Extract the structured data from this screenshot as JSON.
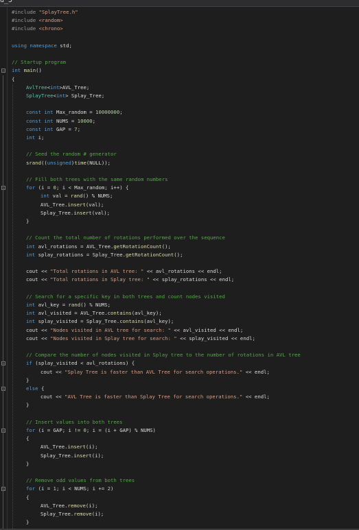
{
  "window": {
    "tab_fragment": "d_5"
  },
  "editor": {
    "lines": [
      {
        "indent": 0,
        "tokens": [
          [
            "pp",
            "#include "
          ],
          [
            "str",
            "\"SplayTree.h\""
          ]
        ]
      },
      {
        "indent": 0,
        "tokens": [
          [
            "pp",
            "#include "
          ],
          [
            "str",
            "<random>"
          ]
        ]
      },
      {
        "indent": 0,
        "tokens": [
          [
            "pp",
            "#include "
          ],
          [
            "str",
            "<chrono>"
          ]
        ]
      },
      {
        "indent": 0,
        "tokens": []
      },
      {
        "indent": 0,
        "tokens": [
          [
            "kw",
            "using namespace "
          ],
          [
            "plain",
            "std;"
          ]
        ]
      },
      {
        "indent": 0,
        "tokens": []
      },
      {
        "indent": 0,
        "tokens": [
          [
            "cm",
            "// Startup program"
          ]
        ]
      },
      {
        "indent": 0,
        "fold": true,
        "tokens": [
          [
            "kw",
            "int "
          ],
          [
            "fn",
            "main"
          ],
          [
            "plain",
            "()"
          ]
        ]
      },
      {
        "indent": 0,
        "tokens": [
          [
            "plain",
            "{"
          ]
        ]
      },
      {
        "indent": 1,
        "tokens": [
          [
            "ty",
            "AvlTree"
          ],
          [
            "plain",
            "<"
          ],
          [
            "kw",
            "int"
          ],
          [
            "plain",
            ">AVL_Tree;"
          ]
        ]
      },
      {
        "indent": 1,
        "tokens": [
          [
            "ty",
            "SplayTree"
          ],
          [
            "plain",
            "<"
          ],
          [
            "kw",
            "int"
          ],
          [
            "plain",
            "> Splay_Tree;"
          ]
        ]
      },
      {
        "indent": 0,
        "tokens": []
      },
      {
        "indent": 1,
        "tokens": [
          [
            "kw",
            "const int "
          ],
          [
            "plain",
            "Max_random = "
          ],
          [
            "num",
            "10000000"
          ],
          [
            "plain",
            ";"
          ]
        ]
      },
      {
        "indent": 1,
        "tokens": [
          [
            "kw",
            "const int "
          ],
          [
            "plain",
            "NUMS = "
          ],
          [
            "num",
            "10000"
          ],
          [
            "plain",
            ";"
          ]
        ]
      },
      {
        "indent": 1,
        "tokens": [
          [
            "kw",
            "const int "
          ],
          [
            "plain",
            "GAP = "
          ],
          [
            "num",
            "7"
          ],
          [
            "plain",
            ";"
          ]
        ]
      },
      {
        "indent": 1,
        "tokens": [
          [
            "kw",
            "int "
          ],
          [
            "plain",
            "i;"
          ]
        ]
      },
      {
        "indent": 0,
        "tokens": []
      },
      {
        "indent": 1,
        "tokens": [
          [
            "cm",
            "// Seed the random # generator"
          ]
        ]
      },
      {
        "indent": 1,
        "tokens": [
          [
            "fn",
            "srand"
          ],
          [
            "plain",
            "(("
          ],
          [
            "kw",
            "unsigned"
          ],
          [
            "plain",
            ")"
          ],
          [
            "fn",
            "time"
          ],
          [
            "plain",
            "(NULL));"
          ]
        ]
      },
      {
        "indent": 0,
        "tokens": []
      },
      {
        "indent": 1,
        "tokens": [
          [
            "cm",
            "// Fill both trees with the same random numbers"
          ]
        ]
      },
      {
        "indent": 1,
        "fold": true,
        "tokens": [
          [
            "kw",
            "for "
          ],
          [
            "plain",
            "(i = "
          ],
          [
            "num",
            "0"
          ],
          [
            "plain",
            "; i < Max_random; i++) {"
          ]
        ]
      },
      {
        "indent": 2,
        "tokens": [
          [
            "kw",
            "int "
          ],
          [
            "plain",
            "val = "
          ],
          [
            "fn",
            "rand"
          ],
          [
            "plain",
            "() % NUMS;"
          ]
        ]
      },
      {
        "indent": 2,
        "tokens": [
          [
            "plain",
            "AVL_Tree."
          ],
          [
            "fn",
            "insert"
          ],
          [
            "plain",
            "(val);"
          ]
        ]
      },
      {
        "indent": 2,
        "tokens": [
          [
            "plain",
            "Splay_Tree."
          ],
          [
            "fn",
            "insert"
          ],
          [
            "plain",
            "(val);"
          ]
        ]
      },
      {
        "indent": 1,
        "tokens": [
          [
            "plain",
            "}"
          ]
        ]
      },
      {
        "indent": 0,
        "tokens": []
      },
      {
        "indent": 1,
        "tokens": [
          [
            "cm",
            "// Count the total number of rotations performed over the sequence"
          ]
        ]
      },
      {
        "indent": 1,
        "tokens": [
          [
            "kw",
            "int "
          ],
          [
            "plain",
            "avl_rotations = AVL_Tree."
          ],
          [
            "fn",
            "getRotationCount"
          ],
          [
            "plain",
            "();"
          ]
        ]
      },
      {
        "indent": 1,
        "tokens": [
          [
            "kw",
            "int "
          ],
          [
            "plain",
            "splay_rotations = Splay_Tree."
          ],
          [
            "fn",
            "getRotationCount"
          ],
          [
            "plain",
            "();"
          ]
        ]
      },
      {
        "indent": 0,
        "tokens": []
      },
      {
        "indent": 1,
        "tokens": [
          [
            "plain",
            "cout << "
          ],
          [
            "str",
            "\"Total rotations in AVL tree: \""
          ],
          [
            "plain",
            " << avl_rotations << endl;"
          ]
        ]
      },
      {
        "indent": 1,
        "tokens": [
          [
            "plain",
            "cout << "
          ],
          [
            "str",
            "\"Total rotations in Splay tree: \""
          ],
          [
            "plain",
            " << splay_rotations << endl;"
          ]
        ]
      },
      {
        "indent": 0,
        "tokens": []
      },
      {
        "indent": 1,
        "tokens": [
          [
            "cm",
            "// Search for a specific key in both trees and count nodes visited"
          ]
        ]
      },
      {
        "indent": 1,
        "tokens": [
          [
            "kw",
            "int "
          ],
          [
            "plain",
            "avl_key = "
          ],
          [
            "fn",
            "rand"
          ],
          [
            "plain",
            "() % NUMS;"
          ]
        ]
      },
      {
        "indent": 1,
        "tokens": [
          [
            "kw",
            "int "
          ],
          [
            "plain",
            "avl_visited = AVL_Tree."
          ],
          [
            "fn",
            "contains"
          ],
          [
            "plain",
            "(avl_key);"
          ]
        ]
      },
      {
        "indent": 1,
        "tokens": [
          [
            "kw",
            "int "
          ],
          [
            "plain",
            "splay_visited = Splay_Tree."
          ],
          [
            "fn",
            "contains"
          ],
          [
            "plain",
            "(avl_key);"
          ]
        ]
      },
      {
        "indent": 1,
        "tokens": [
          [
            "plain",
            "cout << "
          ],
          [
            "str",
            "\"Nodes visited in AVL tree for search: \""
          ],
          [
            "plain",
            " << avl_visited << endl;"
          ]
        ]
      },
      {
        "indent": 1,
        "tokens": [
          [
            "plain",
            "cout << "
          ],
          [
            "str",
            "\"Nodes visited in Splay tree for search: \""
          ],
          [
            "plain",
            " << splay_visited << endl;"
          ]
        ]
      },
      {
        "indent": 0,
        "tokens": []
      },
      {
        "indent": 1,
        "tokens": [
          [
            "cm",
            "// Compare the number of nodes visited in Splay tree to the number of rotations in AVL tree"
          ]
        ]
      },
      {
        "indent": 1,
        "fold": true,
        "tokens": [
          [
            "kw",
            "if "
          ],
          [
            "plain",
            "(splay_visited < avl_rotations) {"
          ]
        ]
      },
      {
        "indent": 2,
        "tokens": [
          [
            "plain",
            "cout << "
          ],
          [
            "str",
            "\"Splay Tree is faster than AVL Tree for search operations.\""
          ],
          [
            "plain",
            " << endl;"
          ]
        ]
      },
      {
        "indent": 1,
        "tokens": [
          [
            "plain",
            "}"
          ]
        ]
      },
      {
        "indent": 1,
        "fold": true,
        "tokens": [
          [
            "kw",
            "else "
          ],
          [
            "plain",
            "{"
          ]
        ]
      },
      {
        "indent": 2,
        "tokens": [
          [
            "plain",
            "cout << "
          ],
          [
            "str",
            "\"AVL Tree is faster than Splay Tree for search operations.\""
          ],
          [
            "plain",
            " << endl;"
          ]
        ]
      },
      {
        "indent": 1,
        "tokens": [
          [
            "plain",
            "}"
          ]
        ]
      },
      {
        "indent": 0,
        "tokens": []
      },
      {
        "indent": 1,
        "tokens": [
          [
            "cm",
            "// Insert values into both trees"
          ]
        ]
      },
      {
        "indent": 1,
        "fold": true,
        "tokens": [
          [
            "kw",
            "for "
          ],
          [
            "plain",
            "(i = GAP; i != "
          ],
          [
            "num",
            "0"
          ],
          [
            "plain",
            "; i = (i + GAP) % NUMS)"
          ]
        ]
      },
      {
        "indent": 1,
        "tokens": [
          [
            "plain",
            "{"
          ]
        ]
      },
      {
        "indent": 2,
        "tokens": [
          [
            "plain",
            "AVL_Tree."
          ],
          [
            "fn",
            "insert"
          ],
          [
            "plain",
            "(i);"
          ]
        ]
      },
      {
        "indent": 2,
        "tokens": [
          [
            "plain",
            "Splay_Tree."
          ],
          [
            "fn",
            "insert"
          ],
          [
            "plain",
            "(i);"
          ]
        ]
      },
      {
        "indent": 1,
        "tokens": [
          [
            "plain",
            "}"
          ]
        ]
      },
      {
        "indent": 0,
        "tokens": []
      },
      {
        "indent": 1,
        "tokens": [
          [
            "cm",
            "// Remove odd values from both trees"
          ]
        ]
      },
      {
        "indent": 1,
        "fold": true,
        "tokens": [
          [
            "kw",
            "for "
          ],
          [
            "plain",
            "(i = "
          ],
          [
            "num",
            "1"
          ],
          [
            "plain",
            "; i < NUMS; i += "
          ],
          [
            "num",
            "2"
          ],
          [
            "plain",
            ")"
          ]
        ]
      },
      {
        "indent": 1,
        "tokens": [
          [
            "plain",
            "{"
          ]
        ]
      },
      {
        "indent": 2,
        "tokens": [
          [
            "plain",
            "AVL_Tree."
          ],
          [
            "fn",
            "remove"
          ],
          [
            "plain",
            "(i);"
          ]
        ]
      },
      {
        "indent": 2,
        "tokens": [
          [
            "plain",
            "Splay_Tree."
          ],
          [
            "fn",
            "remove"
          ],
          [
            "plain",
            "(i);"
          ]
        ]
      },
      {
        "indent": 1,
        "tokens": [
          [
            "plain",
            "}"
          ]
        ]
      }
    ]
  },
  "colors": {
    "background": "#1e1e1e",
    "keyword": "#569cd6",
    "type": "#4ec9b0",
    "function": "#dcdcaa",
    "string": "#d69d85",
    "comment": "#57a64a",
    "number": "#b5cea8",
    "preprocessor": "#9b9b9b",
    "plain": "#dcdcdc"
  }
}
